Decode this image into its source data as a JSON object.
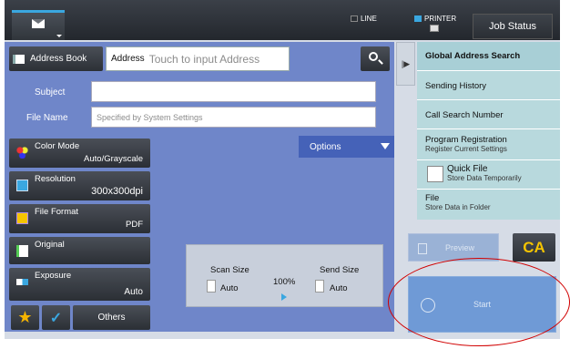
{
  "top_bar": {
    "mail_tab": "",
    "indicators": [
      {
        "label": "LINE",
        "color": "#2b2f35"
      },
      {
        "label": "PRINTER",
        "color": "#3aa7e0"
      }
    ],
    "job_status": "Job Status"
  },
  "address": {
    "address_book": "Address Book",
    "address_label": "Address",
    "address_placeholder": "Touch to input Address"
  },
  "subject": {
    "label": "Subject",
    "value": ""
  },
  "file_name": {
    "label": "File Name",
    "placeholder": "Specified by System Settings"
  },
  "functions": {
    "color_mode": {
      "label": "Color Mode",
      "value": "Auto/Grayscale"
    },
    "resolution": {
      "label": "Resolution",
      "value": "300x300dpi"
    },
    "file_format": {
      "label": "File Format",
      "value": "PDF"
    },
    "original": {
      "label": "Original",
      "value": ""
    },
    "exposure": {
      "label": "Exposure",
      "value": "Auto"
    }
  },
  "options": "Options",
  "scan": {
    "scan_size_label": "Scan Size",
    "scan_size_value": "Auto",
    "ratio": "100%",
    "send_size_label": "Send Size",
    "send_size_value": "Auto"
  },
  "bottom": {
    "others": "Others"
  },
  "right_panel": {
    "items": [
      {
        "label": "Global Address Search",
        "sub": ""
      },
      {
        "label": "Sending History",
        "sub": ""
      },
      {
        "label": "Call Search Number",
        "sub": ""
      },
      {
        "label": "Program Registration",
        "sub": "Register Current Settings"
      },
      {
        "label": "Quick File",
        "sub": "Store Data Temporarily"
      },
      {
        "label": "File",
        "sub": "Store Data in Folder"
      }
    ]
  },
  "preview": "Preview",
  "ca": "CA",
  "start": "Start",
  "colors": {
    "accent": "#3aa7e0",
    "panel_blue": "#6f86c9",
    "ca_yellow": "#f5c400",
    "highlight_ring": "#d10000"
  }
}
